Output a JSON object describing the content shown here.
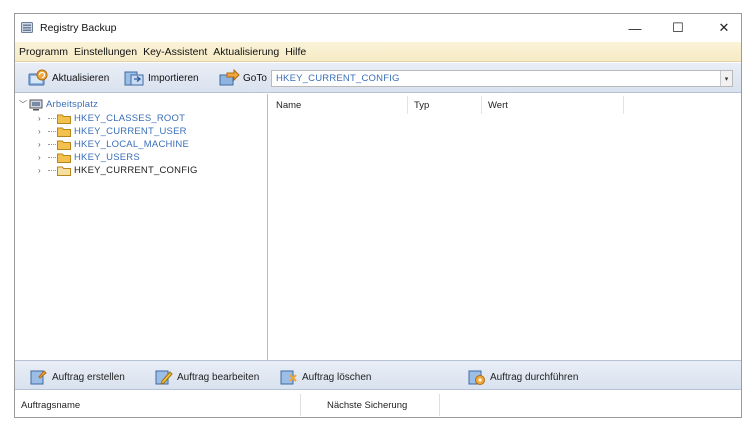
{
  "window": {
    "title": "Registry Backup",
    "controls": {
      "minimize": "—",
      "maximize": "☐",
      "close": "✕"
    }
  },
  "menu": {
    "items": [
      "Programm",
      "Einstellungen",
      "Key-Assistent",
      "Aktualisierung",
      "Hilfe"
    ]
  },
  "toolbar": {
    "refresh_label": "Aktualisieren",
    "import_label": "Importieren",
    "goto_label": "GoTo",
    "path_value": "HKEY_CURRENT_CONFIG",
    "dropdown_glyph": "▾"
  },
  "tree": {
    "root": {
      "label": "Arbeitsplatz",
      "expander": "﹀"
    },
    "expander_collapsed": "›",
    "items": [
      {
        "label": "HKEY_CLASSES_ROOT"
      },
      {
        "label": "HKEY_CURRENT_USER"
      },
      {
        "label": "HKEY_LOCAL_MACHINE"
      },
      {
        "label": "HKEY_USERS"
      },
      {
        "label": "HKEY_CURRENT_CONFIG"
      }
    ]
  },
  "values_list": {
    "columns": [
      "Name",
      "Typ",
      "Wert"
    ]
  },
  "jobs_toolbar": {
    "create_label": "Auftrag erstellen",
    "edit_label": "Auftrag bearbeiten",
    "delete_label": "Auftrag löschen",
    "run_label": "Auftrag durchführen"
  },
  "jobs_table": {
    "columns": [
      "Auftragsname",
      "Nächste Sicherung"
    ]
  },
  "colors": {
    "menu_bar": "#f6ebc6",
    "toolbar": "#dfe6f1",
    "link_text": "#3b6fb8",
    "folder": "#f2c14e"
  }
}
